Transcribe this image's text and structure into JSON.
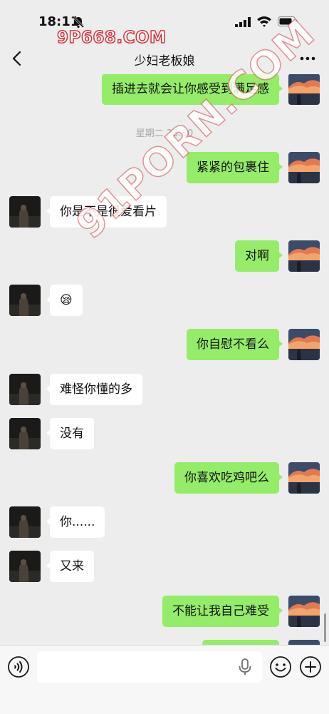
{
  "status_bar": {
    "time": "18:11"
  },
  "watermark_top": "9P668.COM",
  "watermark_diagonal": "91PORN.COM",
  "nav": {
    "title": "少妇老板娘"
  },
  "messages": [
    {
      "sender": "me",
      "text": "插进去就会让你感受到满足感"
    },
    {
      "type": "timestamp",
      "text": "星期二 23:30"
    },
    {
      "sender": "me",
      "text": "紧紧的包裹住"
    },
    {
      "sender": "them",
      "text": "你是不是很爱看片"
    },
    {
      "sender": "me",
      "text": "对啊"
    },
    {
      "sender": "them",
      "text": "😪"
    },
    {
      "sender": "me",
      "text": "你自慰不看么"
    },
    {
      "sender": "them",
      "text": "难怪你懂的多"
    },
    {
      "sender": "them",
      "text": "没有"
    },
    {
      "sender": "me",
      "text": "你喜欢吃鸡吧么"
    },
    {
      "sender": "them",
      "text": "你......"
    },
    {
      "sender": "them",
      "text": "又来"
    },
    {
      "sender": "me",
      "text": "不能让我自己难受"
    }
  ],
  "input": {
    "value": "",
    "placeholder": ""
  },
  "icons": {
    "back": "chevron-left-icon",
    "more": "more-dots-icon",
    "voice": "voice-icon",
    "mic": "mic-icon",
    "emoji": "emoji-icon",
    "plus": "plus-icon"
  },
  "colors": {
    "my_bubble": "#95ec69",
    "their_bubble": "#ffffff",
    "background": "#ededed"
  }
}
